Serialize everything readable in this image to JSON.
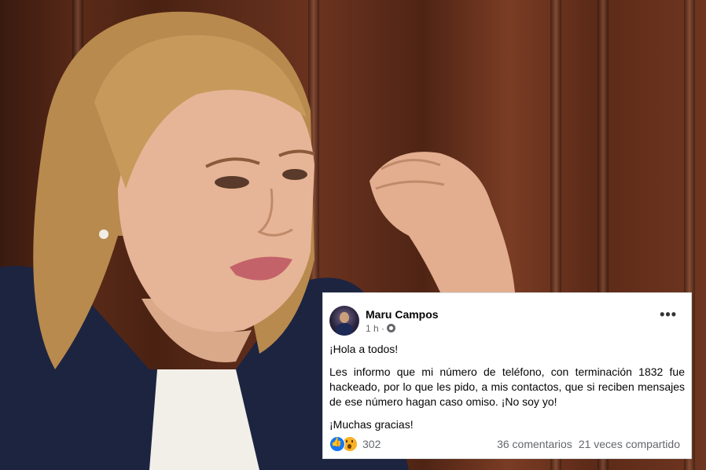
{
  "post": {
    "author": "Maru Campos",
    "time": "1 h ·",
    "more": "•••",
    "paragraphs": [
      "¡Hola a todos!",
      "Les informo que mi número de teléfono, con terminación 1832 fue hackeado, por lo que les pido, a mis contactos, que si reciben mensajes de ese número hagan caso omiso. ¡No soy yo!",
      "¡Muchas gracias!"
    ],
    "reactions": {
      "icons": [
        "like-icon",
        "wow-icon"
      ],
      "count": "302"
    },
    "comments": "36 comentarios",
    "shares": "21 veces compartido"
  },
  "colors": {
    "facebook_blue": "#1877f2",
    "wow_yellow": "#f7b125",
    "secondary_text": "#65676b"
  }
}
